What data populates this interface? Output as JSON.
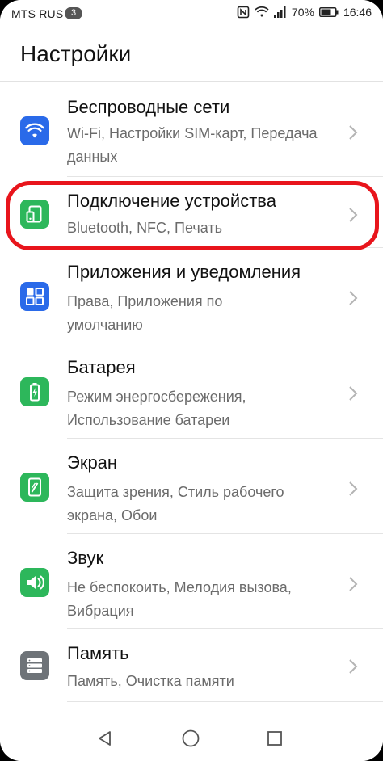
{
  "status_bar": {
    "carrier": "MTS RUS",
    "sim_badge": "3",
    "battery_percent": "70%",
    "time": "16:46",
    "icons": [
      "nfc-icon",
      "wifi-icon",
      "signal-icon",
      "battery-icon"
    ]
  },
  "header": {
    "title": "Настройки"
  },
  "settings_items": [
    {
      "title": "Беспроводные сети",
      "subtitle": "Wi-Fi, Настройки SIM-карт, Передача данных",
      "icon": "wifi-icon",
      "color": "#2a6ae9"
    },
    {
      "title": "Подключение устройства",
      "subtitle": "Bluetooth, NFC, Печать",
      "icon": "device-connection-icon",
      "color": "#2db75b",
      "highlighted": true
    },
    {
      "title": "Приложения и уведомления",
      "subtitle": "Права, Приложения по умолчанию",
      "icon": "apps-grid-icon",
      "color": "#2a6ae9"
    },
    {
      "title": "Батарея",
      "subtitle": "Режим энергосбережения, Использование батареи",
      "icon": "battery-icon",
      "color": "#2db75b"
    },
    {
      "title": "Экран",
      "subtitle": "Защита зрения, Стиль рабочего экрана, Обои",
      "icon": "display-icon",
      "color": "#2db75b"
    },
    {
      "title": "Звук",
      "subtitle": "Не беспокоить, Мелодия вызова, Вибрация",
      "icon": "speaker-icon",
      "color": "#2db75b"
    },
    {
      "title": "Память",
      "subtitle": "Память, Очистка памяти",
      "icon": "storage-icon",
      "color": "#6e7378"
    }
  ],
  "nav_bar": {
    "buttons": [
      "back-icon",
      "home-icon",
      "recents-icon"
    ]
  },
  "colors": {
    "highlight": "#e8151c",
    "chevron": "#b4b4b4"
  }
}
